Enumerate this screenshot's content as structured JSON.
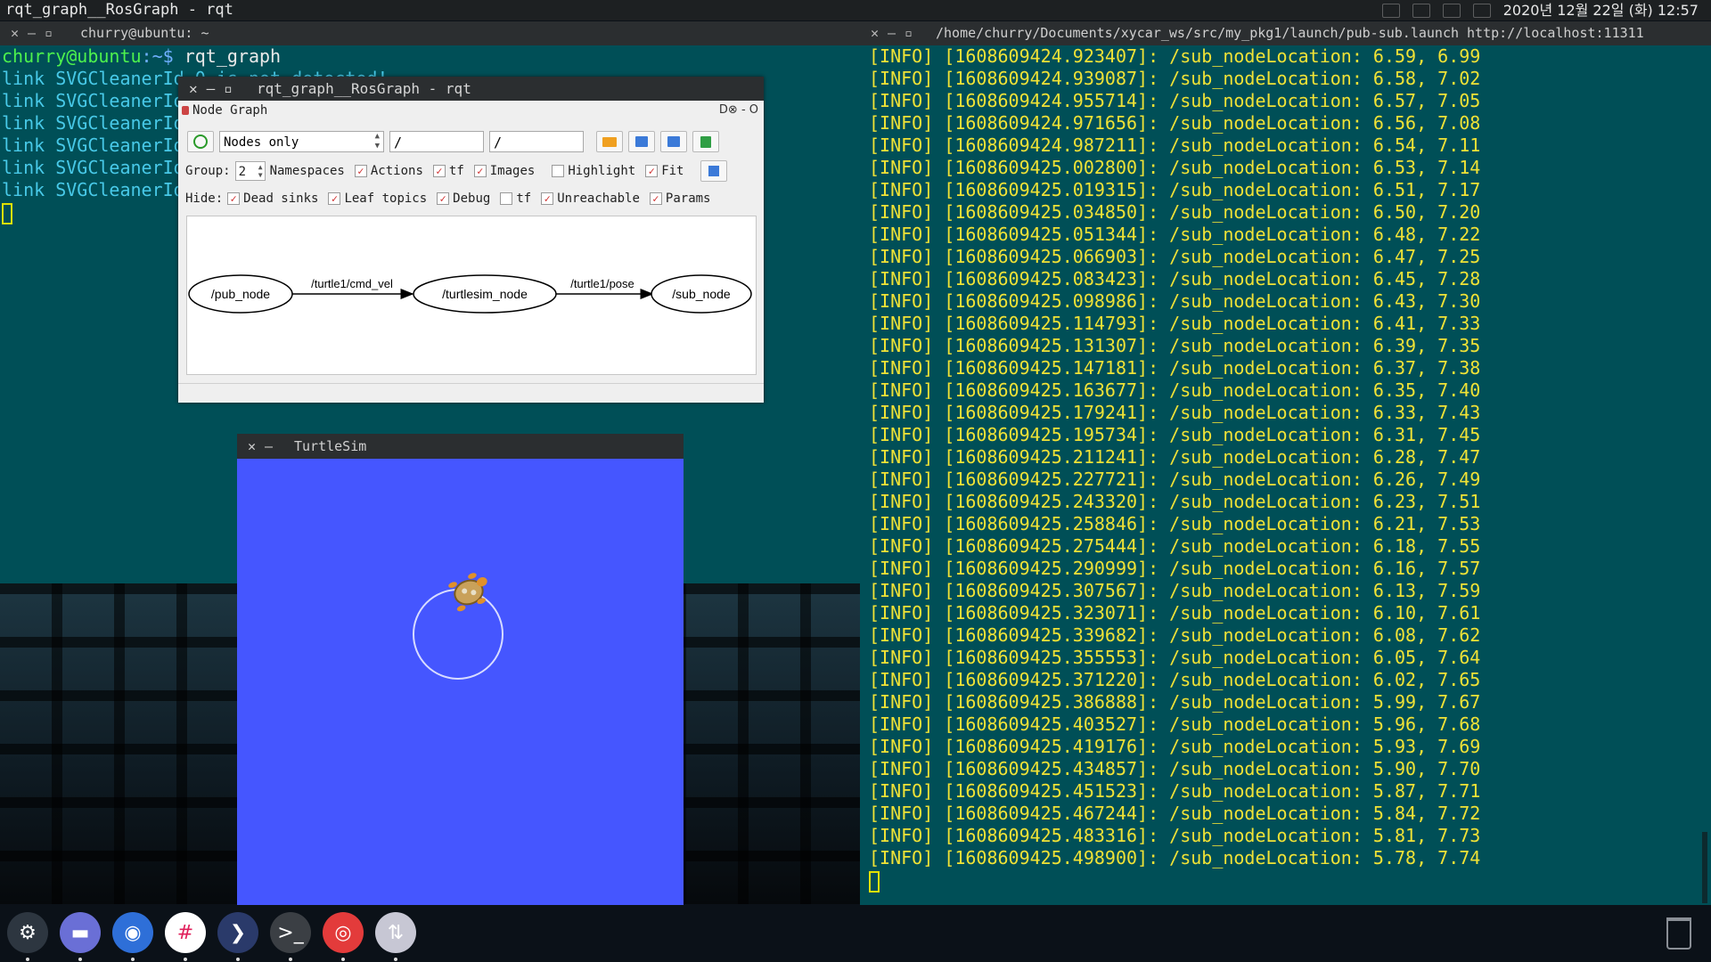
{
  "topbar": {
    "window_title": "rqt_graph__RosGraph - rqt",
    "clock": "2020년 12월 22일 (화) 12:57"
  },
  "left_terminal": {
    "title": "churry@ubuntu: ~",
    "prompt_user": "churry@ubuntu",
    "prompt_path": ":~$",
    "command": " rqt_graph",
    "lines": [
      "link SVGCleanerId 0 is not detected!",
      "link SVGCleanerId 0 is not detected!",
      "link SVGCleanerId 0 is not detected!",
      "link SVGCleanerId 0 is not detected!",
      "link SVGCleanerId 0 is not detected!",
      "link SVGCleanerId 0 is not detected!"
    ]
  },
  "right_terminal": {
    "title": "/home/churry/Documents/xycar_ws/src/my_pkg1/launch/pub-sub.launch http://localhost:11311",
    "logs": [
      "[INFO] [1608609424.923407]: /sub_nodeLocation: 6.59, 6.99",
      "[INFO] [1608609424.939087]: /sub_nodeLocation: 6.58, 7.02",
      "[INFO] [1608609424.955714]: /sub_nodeLocation: 6.57, 7.05",
      "[INFO] [1608609424.971656]: /sub_nodeLocation: 6.56, 7.08",
      "[INFO] [1608609424.987211]: /sub_nodeLocation: 6.54, 7.11",
      "[INFO] [1608609425.002800]: /sub_nodeLocation: 6.53, 7.14",
      "[INFO] [1608609425.019315]: /sub_nodeLocation: 6.51, 7.17",
      "[INFO] [1608609425.034850]: /sub_nodeLocation: 6.50, 7.20",
      "[INFO] [1608609425.051344]: /sub_nodeLocation: 6.48, 7.22",
      "[INFO] [1608609425.066903]: /sub_nodeLocation: 6.47, 7.25",
      "[INFO] [1608609425.083423]: /sub_nodeLocation: 6.45, 7.28",
      "[INFO] [1608609425.098986]: /sub_nodeLocation: 6.43, 7.30",
      "[INFO] [1608609425.114793]: /sub_nodeLocation: 6.41, 7.33",
      "[INFO] [1608609425.131307]: /sub_nodeLocation: 6.39, 7.35",
      "[INFO] [1608609425.147181]: /sub_nodeLocation: 6.37, 7.38",
      "[INFO] [1608609425.163677]: /sub_nodeLocation: 6.35, 7.40",
      "[INFO] [1608609425.179241]: /sub_nodeLocation: 6.33, 7.43",
      "[INFO] [1608609425.195734]: /sub_nodeLocation: 6.31, 7.45",
      "[INFO] [1608609425.211241]: /sub_nodeLocation: 6.28, 7.47",
      "[INFO] [1608609425.227721]: /sub_nodeLocation: 6.26, 7.49",
      "[INFO] [1608609425.243320]: /sub_nodeLocation: 6.23, 7.51",
      "[INFO] [1608609425.258846]: /sub_nodeLocation: 6.21, 7.53",
      "[INFO] [1608609425.275444]: /sub_nodeLocation: 6.18, 7.55",
      "[INFO] [1608609425.290999]: /sub_nodeLocation: 6.16, 7.57",
      "[INFO] [1608609425.307567]: /sub_nodeLocation: 6.13, 7.59",
      "[INFO] [1608609425.323071]: /sub_nodeLocation: 6.10, 7.61",
      "[INFO] [1608609425.339682]: /sub_nodeLocation: 6.08, 7.62",
      "[INFO] [1608609425.355553]: /sub_nodeLocation: 6.05, 7.64",
      "[INFO] [1608609425.371220]: /sub_nodeLocation: 6.02, 7.65",
      "[INFO] [1608609425.386888]: /sub_nodeLocation: 5.99, 7.67",
      "[INFO] [1608609425.403527]: /sub_nodeLocation: 5.96, 7.68",
      "[INFO] [1608609425.419176]: /sub_nodeLocation: 5.93, 7.69",
      "[INFO] [1608609425.434857]: /sub_nodeLocation: 5.90, 7.70",
      "[INFO] [1608609425.451523]: /sub_nodeLocation: 5.87, 7.71",
      "[INFO] [1608609425.467244]: /sub_nodeLocation: 5.84, 7.72",
      "[INFO] [1608609425.483316]: /sub_nodeLocation: 5.81, 7.73",
      "[INFO] [1608609425.498900]: /sub_nodeLocation: 5.78, 7.74"
    ]
  },
  "rqt": {
    "title": "rqt_graph__RosGraph - rqt",
    "plugin_title": "Node Graph",
    "plugin_controls": "D⊗ - O",
    "mode_combo": "Nodes only",
    "ns_filter": "/",
    "topic_filter": "/",
    "group_label": "Group:",
    "group_value": "2",
    "namespaces_label": "Namespaces",
    "hide_label": "Hide:",
    "checks_row2": [
      {
        "label": "Actions",
        "checked": true
      },
      {
        "label": "tf",
        "checked": true
      },
      {
        "label": "Images",
        "checked": true
      },
      {
        "label": "Highlight",
        "checked": false
      },
      {
        "label": "Fit",
        "checked": true
      }
    ],
    "checks_row3": [
      {
        "label": "Dead sinks",
        "checked": true
      },
      {
        "label": "Leaf topics",
        "checked": true
      },
      {
        "label": "Debug",
        "checked": true
      },
      {
        "label": "tf",
        "checked": false
      },
      {
        "label": "Unreachable",
        "checked": true
      },
      {
        "label": "Params",
        "checked": true
      }
    ],
    "graph": {
      "nodes": [
        "/pub_node",
        "/turtlesim_node",
        "/sub_node"
      ],
      "edges": [
        "/turtle1/cmd_vel",
        "/turtle1/pose"
      ]
    }
  },
  "turtlesim": {
    "title": "TurtleSim",
    "background": "#4556ff"
  },
  "dock": {
    "apps": [
      {
        "name": "settings-app",
        "color": "#2d3640",
        "glyph": "⚙"
      },
      {
        "name": "files-app",
        "color": "#6a6fd6",
        "glyph": "▬"
      },
      {
        "name": "chrome-app",
        "color": "#2e6fd8",
        "glyph": "◉"
      },
      {
        "name": "slack-app",
        "color": "#ffffff",
        "glyph": "#"
      },
      {
        "name": "vscode-app",
        "color": "#2a3a6a",
        "glyph": "❯"
      },
      {
        "name": "terminal-app",
        "color": "#3b3f44",
        "glyph": ">_"
      },
      {
        "name": "ubuntu-app",
        "color": "#e33b3b",
        "glyph": "◎"
      },
      {
        "name": "transfer-app",
        "color": "#c7c7d4",
        "glyph": "⇅"
      }
    ]
  }
}
